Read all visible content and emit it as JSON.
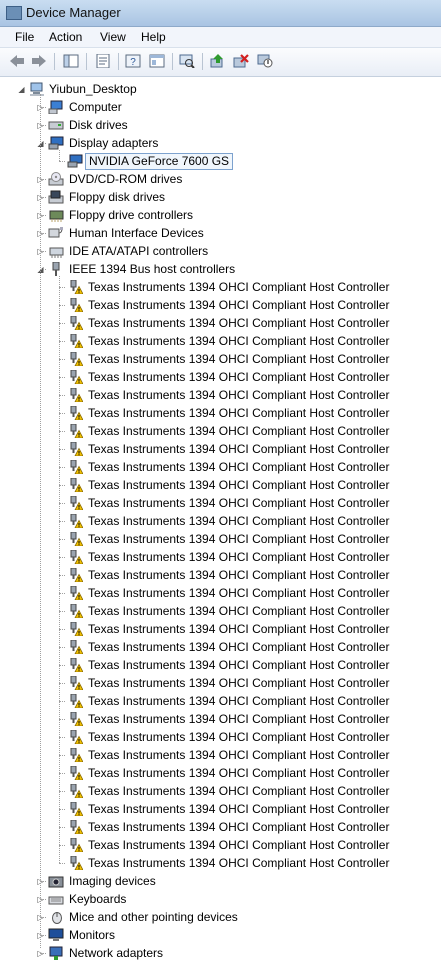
{
  "window": {
    "title": "Device Manager"
  },
  "menu": [
    "File",
    "Action",
    "View",
    "Help"
  ],
  "toolbar": {
    "buttons": [
      "back-icon",
      "forward-icon",
      "show-hide-console-tree-icon",
      "properties-icon",
      "help-icon",
      "show-view-icon",
      "scan-hardware-icon",
      "update-driver-icon",
      "uninstall-icon",
      "disable-icon"
    ]
  },
  "tree": {
    "root": "Yiubun_Desktop",
    "categories_before": [
      {
        "label": "Computer",
        "icon": "computer-icon"
      },
      {
        "label": "Disk drives",
        "icon": "disk-drive-icon"
      }
    ],
    "display_adapters": {
      "label": "Display adapters",
      "children": [
        "NVIDIA GeForce 7600 GS"
      ]
    },
    "categories_mid": [
      {
        "label": "DVD/CD-ROM drives",
        "icon": "dvd-drive-icon"
      },
      {
        "label": "Floppy disk drives",
        "icon": "floppy-drive-icon"
      },
      {
        "label": "Floppy drive controllers",
        "icon": "floppy-controller-icon"
      },
      {
        "label": "Human Interface Devices",
        "icon": "hid-icon"
      },
      {
        "label": "IDE ATA/ATAPI controllers",
        "icon": "ide-controller-icon"
      }
    ],
    "ieee1394": {
      "label": "IEEE 1394 Bus host controllers",
      "children": [
        "Texas Instruments 1394 OHCI Compliant Host Controller",
        "Texas Instruments 1394 OHCI Compliant Host Controller",
        "Texas Instruments 1394 OHCI Compliant Host Controller",
        "Texas Instruments 1394 OHCI Compliant Host Controller",
        "Texas Instruments 1394 OHCI Compliant Host Controller",
        "Texas Instruments 1394 OHCI Compliant Host Controller",
        "Texas Instruments 1394 OHCI Compliant Host Controller",
        "Texas Instruments 1394 OHCI Compliant Host Controller",
        "Texas Instruments 1394 OHCI Compliant Host Controller",
        "Texas Instruments 1394 OHCI Compliant Host Controller",
        "Texas Instruments 1394 OHCI Compliant Host Controller",
        "Texas Instruments 1394 OHCI Compliant Host Controller",
        "Texas Instruments 1394 OHCI Compliant Host Controller",
        "Texas Instruments 1394 OHCI Compliant Host Controller",
        "Texas Instruments 1394 OHCI Compliant Host Controller",
        "Texas Instruments 1394 OHCI Compliant Host Controller",
        "Texas Instruments 1394 OHCI Compliant Host Controller",
        "Texas Instruments 1394 OHCI Compliant Host Controller",
        "Texas Instruments 1394 OHCI Compliant Host Controller",
        "Texas Instruments 1394 OHCI Compliant Host Controller",
        "Texas Instruments 1394 OHCI Compliant Host Controller",
        "Texas Instruments 1394 OHCI Compliant Host Controller",
        "Texas Instruments 1394 OHCI Compliant Host Controller",
        "Texas Instruments 1394 OHCI Compliant Host Controller",
        "Texas Instruments 1394 OHCI Compliant Host Controller",
        "Texas Instruments 1394 OHCI Compliant Host Controller",
        "Texas Instruments 1394 OHCI Compliant Host Controller",
        "Texas Instruments 1394 OHCI Compliant Host Controller",
        "Texas Instruments 1394 OHCI Compliant Host Controller",
        "Texas Instruments 1394 OHCI Compliant Host Controller",
        "Texas Instruments 1394 OHCI Compliant Host Controller",
        "Texas Instruments 1394 OHCI Compliant Host Controller",
        "Texas Instruments 1394 OHCI Compliant Host Controller"
      ]
    },
    "categories_after": [
      {
        "label": "Imaging devices",
        "icon": "imaging-device-icon"
      },
      {
        "label": "Keyboards",
        "icon": "keyboard-icon"
      },
      {
        "label": "Mice and other pointing devices",
        "icon": "mouse-icon"
      },
      {
        "label": "Monitors",
        "icon": "monitor-icon"
      },
      {
        "label": "Network adapters",
        "icon": "network-adapter-icon"
      }
    ]
  },
  "colors": {
    "warning": "#f2c200",
    "selection_border": "#7da2ce",
    "title_bar": "#b6cee8"
  }
}
